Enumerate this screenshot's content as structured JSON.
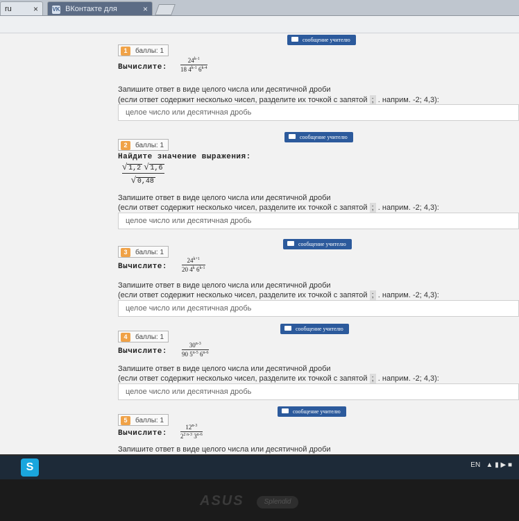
{
  "tabs": [
    {
      "label": "ru",
      "close": "×"
    },
    {
      "label": "ВКонтакте для мобиль...",
      "close": "×"
    }
  ],
  "badge_label": "баллы: 1",
  "compute_label": "Вычислите:",
  "find_value_label": "Найдите значение выражения:",
  "instruction_line1": "Запишите ответ в виде целого числа или десятичной дроби",
  "instruction_line2_pre": "(если ответ содержит несколько чисел, разделите их точкой с запятой",
  "semicolon": ";",
  "instruction_line2_post": ". наприм. -2; 4,3):",
  "input_placeholder": "целое число или десятичная дробь",
  "message_button": "сообщение учителю",
  "questions": [
    {
      "num": "1",
      "numerator": "24",
      "numerator_exp": "k-1",
      "denominator": "18 4",
      "den_exp1": "k-1",
      "den_mid": " 6",
      "den_exp2": "k-4"
    },
    {
      "num": "2",
      "sqrt_a": "1,2",
      "sqrt_b": "1,6",
      "sqrt_c": "0,48"
    },
    {
      "num": "3",
      "numerator": "24",
      "numerator_exp": "k+1",
      "denominator": "20 4",
      "den_exp1": "k",
      "den_mid": " 6",
      "den_exp2": "k-1"
    },
    {
      "num": "4",
      "numerator": "30",
      "numerator_exp": "n-3",
      "denominator": "90 5",
      "den_exp1": "n-5",
      "den_mid": " 6",
      "den_exp2": "n-6"
    },
    {
      "num": "5",
      "numerator": "12",
      "numerator_exp": "n-3",
      "denominator": "2",
      "den_exp1": "2 n-3",
      "den_mid": " 3",
      "den_exp2": "n-6"
    }
  ],
  "tray": {
    "lang": "EN",
    "icons": "▲ ▮ ▶ ■"
  },
  "brand": {
    "asus": "ASUS",
    "splendid": "Splendid"
  }
}
